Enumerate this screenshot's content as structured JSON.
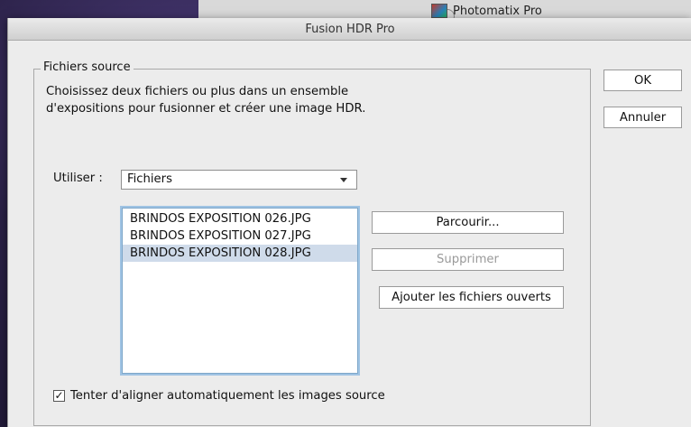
{
  "background": {
    "app_item_label": "Photomatix Pro"
  },
  "dialog": {
    "title": "Fusion HDR Pro",
    "group_title": "Fichiers source",
    "description": "Choisissez deux fichiers ou plus dans un ensemble d'expositions pour fusionner et créer une image HDR.",
    "use_label": "Utiliser :",
    "use_select": {
      "selected": "Fichiers"
    },
    "files": [
      {
        "name": "BRINDOS EXPOSITION 026.JPG",
        "selected": false
      },
      {
        "name": "BRINDOS EXPOSITION 027.JPG",
        "selected": false
      },
      {
        "name": "BRINDOS EXPOSITION 028.JPG",
        "selected": true
      }
    ],
    "buttons": {
      "ok": "OK",
      "cancel": "Annuler",
      "browse": "Parcourir...",
      "remove": "Supprimer",
      "add_open": "Ajouter les fichiers ouverts"
    },
    "checkbox": {
      "label": "Tenter d'aligner automatiquement les images source",
      "checked": true
    }
  }
}
